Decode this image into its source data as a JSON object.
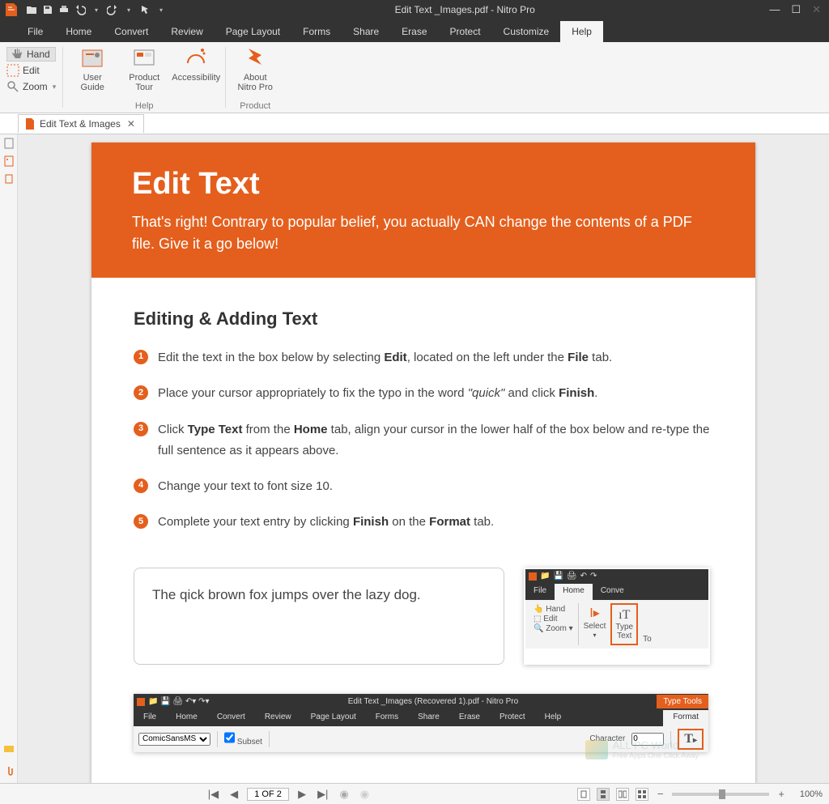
{
  "titlebar": {
    "title": "Edit Text _Images.pdf - Nitro Pro"
  },
  "menu": {
    "file": "File",
    "tabs": [
      "Home",
      "Convert",
      "Review",
      "Page Layout",
      "Forms",
      "Share",
      "Erase",
      "Protect",
      "Customize",
      "Help"
    ],
    "active": "Help"
  },
  "tools": {
    "hand": "Hand",
    "edit": "Edit",
    "zoom": "Zoom"
  },
  "ribbon": {
    "help": {
      "user_guide": "User\nGuide",
      "product_tour": "Product\nTour",
      "accessibility": "Accessibility",
      "group": "Help"
    },
    "product": {
      "about": "About\nNitro Pro",
      "group": "Product"
    }
  },
  "doctab": {
    "label": "Edit Text & Images"
  },
  "doc": {
    "hero_title": "Edit Text",
    "hero_sub": "That's right! Contrary to popular belief, you actually CAN change the contents of a PDF file. Give it a go below!",
    "section_title": "Editing & Adding Text",
    "steps": [
      {
        "n": "1",
        "pre": "Edit the text in the box below by selecting ",
        "b1": "Edit",
        "mid": ", located on the left under the ",
        "b2": "File",
        "post": " tab."
      },
      {
        "n": "2",
        "pre": "Place your cursor appropriately to fix the typo in the word ",
        "i": "\"quick\"",
        "mid": " and click ",
        "b1": "Finish",
        "post": "."
      },
      {
        "n": "3",
        "pre": "Click ",
        "b1": "Type Text",
        "mid": " from the ",
        "b2": "Home",
        "mid2": " tab, align your cursor in the lower half of the box below and re-type the full sentence as it appears above."
      },
      {
        "n": "4",
        "pre": "Change your text to font size 10."
      },
      {
        "n": "5",
        "pre": "Complete your text entry by clicking ",
        "b1": "Finish",
        "mid": " on the ",
        "b2": "Format",
        "post": " tab."
      }
    ],
    "typing_sample": "The qick brown fox jumps over the lazy dog.",
    "watermark": {
      "line1": "ALL PC World",
      "line2": "Free Apps One Click Away"
    }
  },
  "mini1": {
    "file": "File",
    "home": "Home",
    "convert": "Conve",
    "hand": "Hand",
    "edit": "Edit",
    "zoom": "Zoom",
    "select": "Select",
    "typetext": "Type\nText",
    "to": "To"
  },
  "mini2": {
    "title": "Edit Text _Images (Recovered 1).pdf - Nitro Pro",
    "typetools": "Type Tools",
    "tabs": [
      "File",
      "Home",
      "Convert",
      "Review",
      "Page Layout",
      "Forms",
      "Share",
      "Erase",
      "Protect",
      "Help"
    ],
    "format": "Format",
    "font": "ComicSansMS",
    "subset": "Subset",
    "character": "Character",
    "charval": "0"
  },
  "status": {
    "page_input": "1 OF 2",
    "zoom": "100%"
  }
}
